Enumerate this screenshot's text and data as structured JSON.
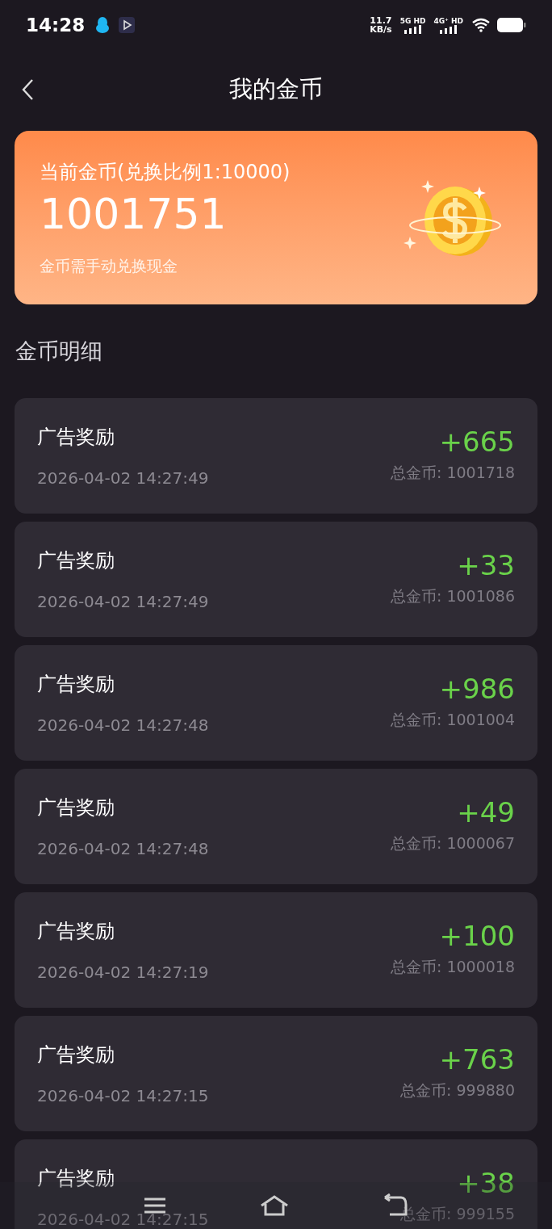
{
  "status_bar": {
    "time": "14:28",
    "speed": "11.7",
    "speed_unit": "KB/s",
    "net1": "5G HD",
    "net2": "4G⁺ HD"
  },
  "header": {
    "title": "我的金币"
  },
  "balance_card": {
    "label": "当前金币(兑换比例1:10000)",
    "value": "1001751",
    "note": "金币需手动兑换现金"
  },
  "section_title": "金币明细",
  "records": [
    {
      "title": "广告奖励",
      "time": "2026-04-02 14:27:49",
      "amount": "+665",
      "total": "总金币: 1001718"
    },
    {
      "title": "广告奖励",
      "time": "2026-04-02 14:27:49",
      "amount": "+33",
      "total": "总金币: 1001086"
    },
    {
      "title": "广告奖励",
      "time": "2026-04-02 14:27:48",
      "amount": "+986",
      "total": "总金币: 1001004"
    },
    {
      "title": "广告奖励",
      "time": "2026-04-02 14:27:48",
      "amount": "+49",
      "total": "总金币: 1000067"
    },
    {
      "title": "广告奖励",
      "time": "2026-04-02 14:27:19",
      "amount": "+100",
      "total": "总金币: 1000018"
    },
    {
      "title": "广告奖励",
      "time": "2026-04-02 14:27:15",
      "amount": "+763",
      "total": "总金币: 999880"
    },
    {
      "title": "广告奖励",
      "time": "2026-04-02 14:27:15",
      "amount": "+38",
      "total": "总金币: 999155"
    }
  ]
}
